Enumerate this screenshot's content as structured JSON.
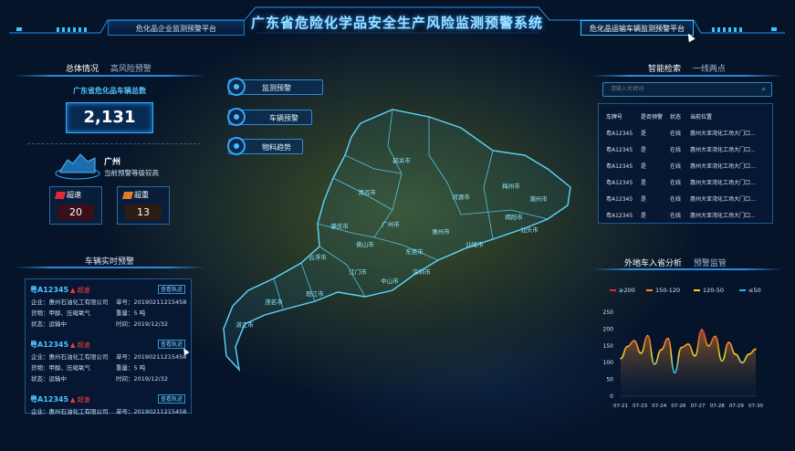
{
  "header": {
    "title": "广东省危险化学品安全生产风险监测预警系统",
    "left_tab": "危化品企业监测预警平台",
    "right_tab": "危化品运输车辆监测预警平台"
  },
  "left_panel": {
    "tabs": [
      "总体情况",
      "高风险预警"
    ],
    "total_title": "广东省危化品车辆总数",
    "total_value": "2,131",
    "city": "广州",
    "city_subtitle": "当前预警等级较高",
    "stats": [
      {
        "label": "超速",
        "value": "20",
        "color": "#e0293a"
      },
      {
        "label": "超重",
        "value": "13",
        "color": "#e07a29"
      }
    ]
  },
  "alerts": {
    "title": "车辆实时预警",
    "items": [
      {
        "plate": "粤A12345",
        "warn": "▲ 超速",
        "track": "查看轨迹",
        "company_lbl": "企业：",
        "company": "惠州石油化工有限公司",
        "order_lbl": "单号：",
        "order": "2019021121545​8",
        "goods_lbl": "货物：",
        "goods": "甲醇、压缩氧气",
        "weight_lbl": "重量：",
        "weight": "5 吨",
        "status_lbl": "状态：",
        "status": "运输中",
        "time_lbl": "时间：",
        "time": "2019/12/32"
      },
      {
        "plate": "粤A12345",
        "warn": "▲ 超速",
        "track": "查看轨迹",
        "company_lbl": "企业：",
        "company": "惠州石油化工有限公司",
        "order_lbl": "单号：",
        "order": "20190211215458",
        "goods_lbl": "货物：",
        "goods": "甲醇、压缩氧气",
        "weight_lbl": "重量：",
        "weight": "5 吨",
        "status_lbl": "状态：",
        "status": "运输中",
        "time_lbl": "时间：",
        "time": "2019/12/32"
      },
      {
        "plate": "粤A12345",
        "warn": "▲ 超速",
        "track": "查看轨迹",
        "company_lbl": "企业：",
        "company": "惠州石油化工有限公司",
        "order_lbl": "单号：",
        "order": "20190211215458"
      }
    ]
  },
  "side_buttons": [
    "监测预警",
    "车辆预警",
    "物料趋势"
  ],
  "map": {
    "cities": [
      "韶关市",
      "梅州市",
      "清远市",
      "河源市",
      "潮州市",
      "肇庆市",
      "广州市",
      "揭阳市",
      "惠州市",
      "汕头市",
      "云浮市",
      "佛山市",
      "东莞市",
      "汕尾市",
      "江门市",
      "深圳市",
      "中山市",
      "阳江市",
      "茂名市",
      "湛江市"
    ]
  },
  "right_panel": {
    "tabs": [
      "智能检索",
      "一线两点"
    ],
    "search_placeholder": "请输入关键词",
    "columns": [
      "车牌号",
      "是否预警",
      "状态",
      "当前位置"
    ],
    "rows": [
      [
        "粤A12345",
        "是",
        "在线",
        "惠州大亚湾化工场大门口..."
      ],
      [
        "粤A12345",
        "是",
        "在线",
        "惠州大亚湾化工场大门口..."
      ],
      [
        "粤A12345",
        "是",
        "在线",
        "惠州大亚湾化工场大门口..."
      ],
      [
        "粤A12345",
        "是",
        "在线",
        "惠州大亚湾化工场大门口..."
      ],
      [
        "粤A12345",
        "是",
        "在线",
        "惠州大亚湾化工场大门口..."
      ],
      [
        "粤A12345",
        "是",
        "在线",
        "惠州大亚湾化工场大门口..."
      ]
    ]
  },
  "chart_panel": {
    "tabs": [
      "外地车入省分析",
      "预警监管"
    ],
    "legend": [
      {
        "label": "≥200",
        "color": "#e0293a"
      },
      {
        "label": "150-120",
        "color": "#f08a24"
      },
      {
        "label": "120-50",
        "color": "#f5d020"
      },
      {
        "label": "≤50",
        "color": "#22b8f0"
      }
    ]
  },
  "chart_data": {
    "type": "area",
    "title": "",
    "xlabel": "",
    "ylabel": "",
    "categories": [
      "07-21",
      "07-23",
      "07-24",
      "07-26",
      "07-27",
      "07-28",
      "07-29",
      "07-30"
    ],
    "x": [
      0,
      0.35,
      0.7,
      1.05,
      1.4,
      1.75,
      2.1,
      2.45,
      2.8,
      3.15,
      3.5,
      3.85,
      4.2,
      4.55,
      4.9,
      5.25,
      5.6,
      5.95,
      6.3,
      6.65,
      7
    ],
    "series": [
      {
        "values": [
          112,
          148,
          165,
          128,
          180,
          95,
          138,
          172,
          70,
          145,
          155,
          120,
          198,
          150,
          178,
          105,
          160,
          125,
          100,
          125,
          140
        ]
      }
    ],
    "ylim": [
      0,
      250
    ],
    "yticks": [
      0,
      50,
      100,
      150,
      200,
      250
    ],
    "grid": false
  }
}
